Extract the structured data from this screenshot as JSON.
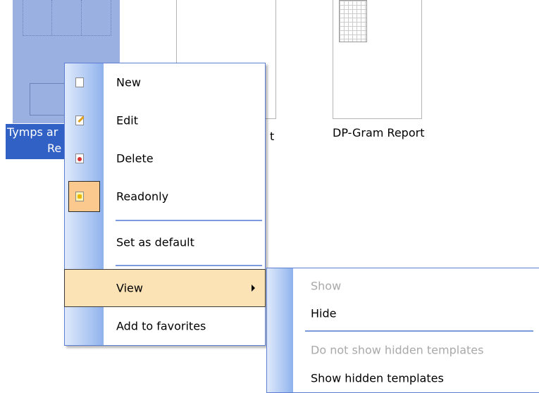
{
  "thumbnails": [
    {
      "label": "Tymps and Reflex Report",
      "label_line1": "Tymps ar",
      "label_line2": "Re",
      "selected": true
    },
    {
      "label_tail": "t",
      "selected": false
    },
    {
      "label": "DP-Gram Report",
      "selected": false
    }
  ],
  "context_menu": {
    "items": [
      {
        "label": "New",
        "icon": "document-new-icon"
      },
      {
        "label": "Edit",
        "icon": "edit-pencil-icon"
      },
      {
        "label": "Delete",
        "icon": "delete-icon"
      },
      {
        "label": "Readonly",
        "icon": "readonly-lock-icon",
        "checked": true
      },
      {
        "label": "Set as default"
      },
      {
        "label": "View",
        "has_submenu": true,
        "highlighted": true
      },
      {
        "label": "Add to favorites"
      }
    ]
  },
  "submenu": {
    "items": [
      {
        "label": "Show",
        "disabled": true
      },
      {
        "label": "Hide",
        "disabled": false
      },
      {
        "label": "Do not show hidden templates",
        "disabled": true
      },
      {
        "label": "Show hidden templates",
        "disabled": false
      }
    ]
  },
  "colors": {
    "selection_bg": "#3161c5",
    "menu_border": "#5d7ed2",
    "highlight": "#fce3b5",
    "checked_frame": "#fbc98e"
  }
}
